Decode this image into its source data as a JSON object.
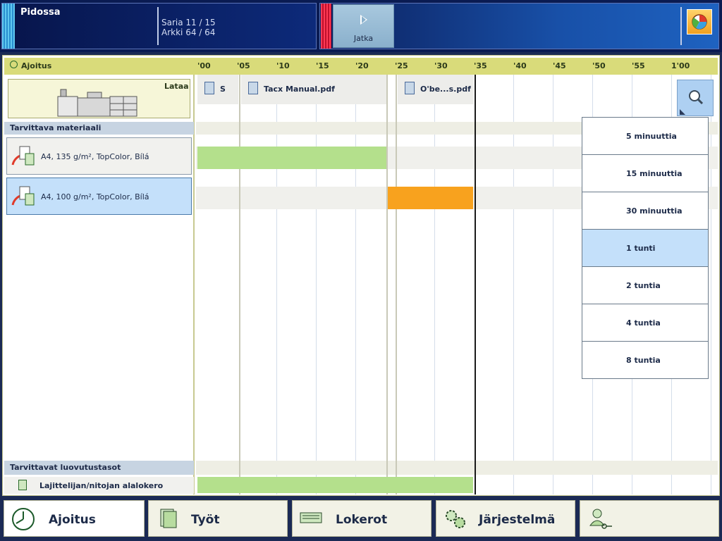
{
  "status": {
    "title": "Pidossa",
    "set_line": "Saria 11 / 15",
    "sheet_line": "Arkki 64 / 64"
  },
  "controls": {
    "continue_label": "Jatka"
  },
  "schedule": {
    "header_label": "Ajoitus",
    "ticks": [
      "'00",
      "'05",
      "'10",
      "'15",
      "'20",
      "'25",
      "'30",
      "'35",
      "'40",
      "'45",
      "'50",
      "'55",
      "1'00"
    ],
    "load_label": "Lataa",
    "materials_header": "Tarvittava materiaali",
    "materials": [
      {
        "label": "A4",
        "detail": ", 135 g/m², TopColor, Bílá"
      },
      {
        "label": "A4",
        "detail": ", 100 g/m², TopColor, Bílá"
      }
    ],
    "jobs": [
      {
        "name": "S"
      },
      {
        "name": "Tacx Manual.pdf"
      },
      {
        "name": "O'be...s.pdf"
      }
    ],
    "outputs_header": "Tarvittavat luovutustasot",
    "output_tray": "Lajittelijan/nitojan alalokero",
    "colors": {
      "green_bar": "#b4e08c",
      "orange_bar": "#f8a21e",
      "selected": "#c4e0fa"
    }
  },
  "zoom_menu": {
    "options": [
      "5 minuuttia",
      "15 minuuttia",
      "30 minuuttia",
      "1 tunti",
      "2 tuntia",
      "4 tuntia",
      "8 tuntia"
    ],
    "selected": "1 tunti"
  },
  "nav": {
    "tabs": [
      {
        "label": "Ajoitus",
        "icon": "clock-icon"
      },
      {
        "label": "Työt",
        "icon": "document-icon"
      },
      {
        "label": "Lokerot",
        "icon": "tray-icon"
      },
      {
        "label": "Järjestelmä",
        "icon": "gears-icon"
      },
      {
        "label": "",
        "icon": "user-key-icon"
      }
    ]
  }
}
